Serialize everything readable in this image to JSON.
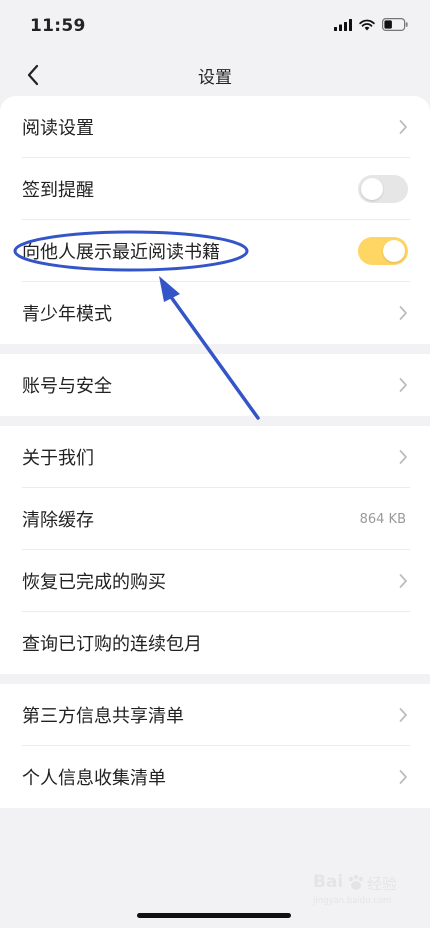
{
  "status_bar": {
    "time": "11:59"
  },
  "nav": {
    "title": "设置",
    "back_icon": "chevron-left-icon"
  },
  "groups": [
    {
      "rows": [
        {
          "label": "阅读设置",
          "control": "chevron"
        },
        {
          "label": "签到提醒",
          "control": "toggle",
          "on": false
        },
        {
          "label": "向他人展示最近阅读书籍",
          "control": "toggle",
          "on": true
        },
        {
          "label": "青少年模式",
          "control": "chevron"
        }
      ]
    },
    {
      "rows": [
        {
          "label": "账号与安全",
          "control": "chevron"
        }
      ]
    },
    {
      "rows": [
        {
          "label": "关于我们",
          "control": "chevron"
        },
        {
          "label": "清除缓存",
          "control": "value",
          "value": "864 KB"
        },
        {
          "label": "恢复已完成的购买",
          "control": "chevron"
        },
        {
          "label": "查询已订购的连续包月",
          "control": "none"
        }
      ]
    },
    {
      "rows": [
        {
          "label": "第三方信息共享清单",
          "control": "chevron"
        },
        {
          "label": "个人信息收集清单",
          "control": "chevron"
        }
      ]
    }
  ],
  "colors": {
    "toggle_on": "#ffd564",
    "toggle_off": "#e6e6e6",
    "annotation": "#3355c8",
    "background": "#f2f2f4"
  },
  "watermark": {
    "brand": "Bai",
    "suffix": "经验",
    "domain": "jingyan.baidu.com"
  }
}
